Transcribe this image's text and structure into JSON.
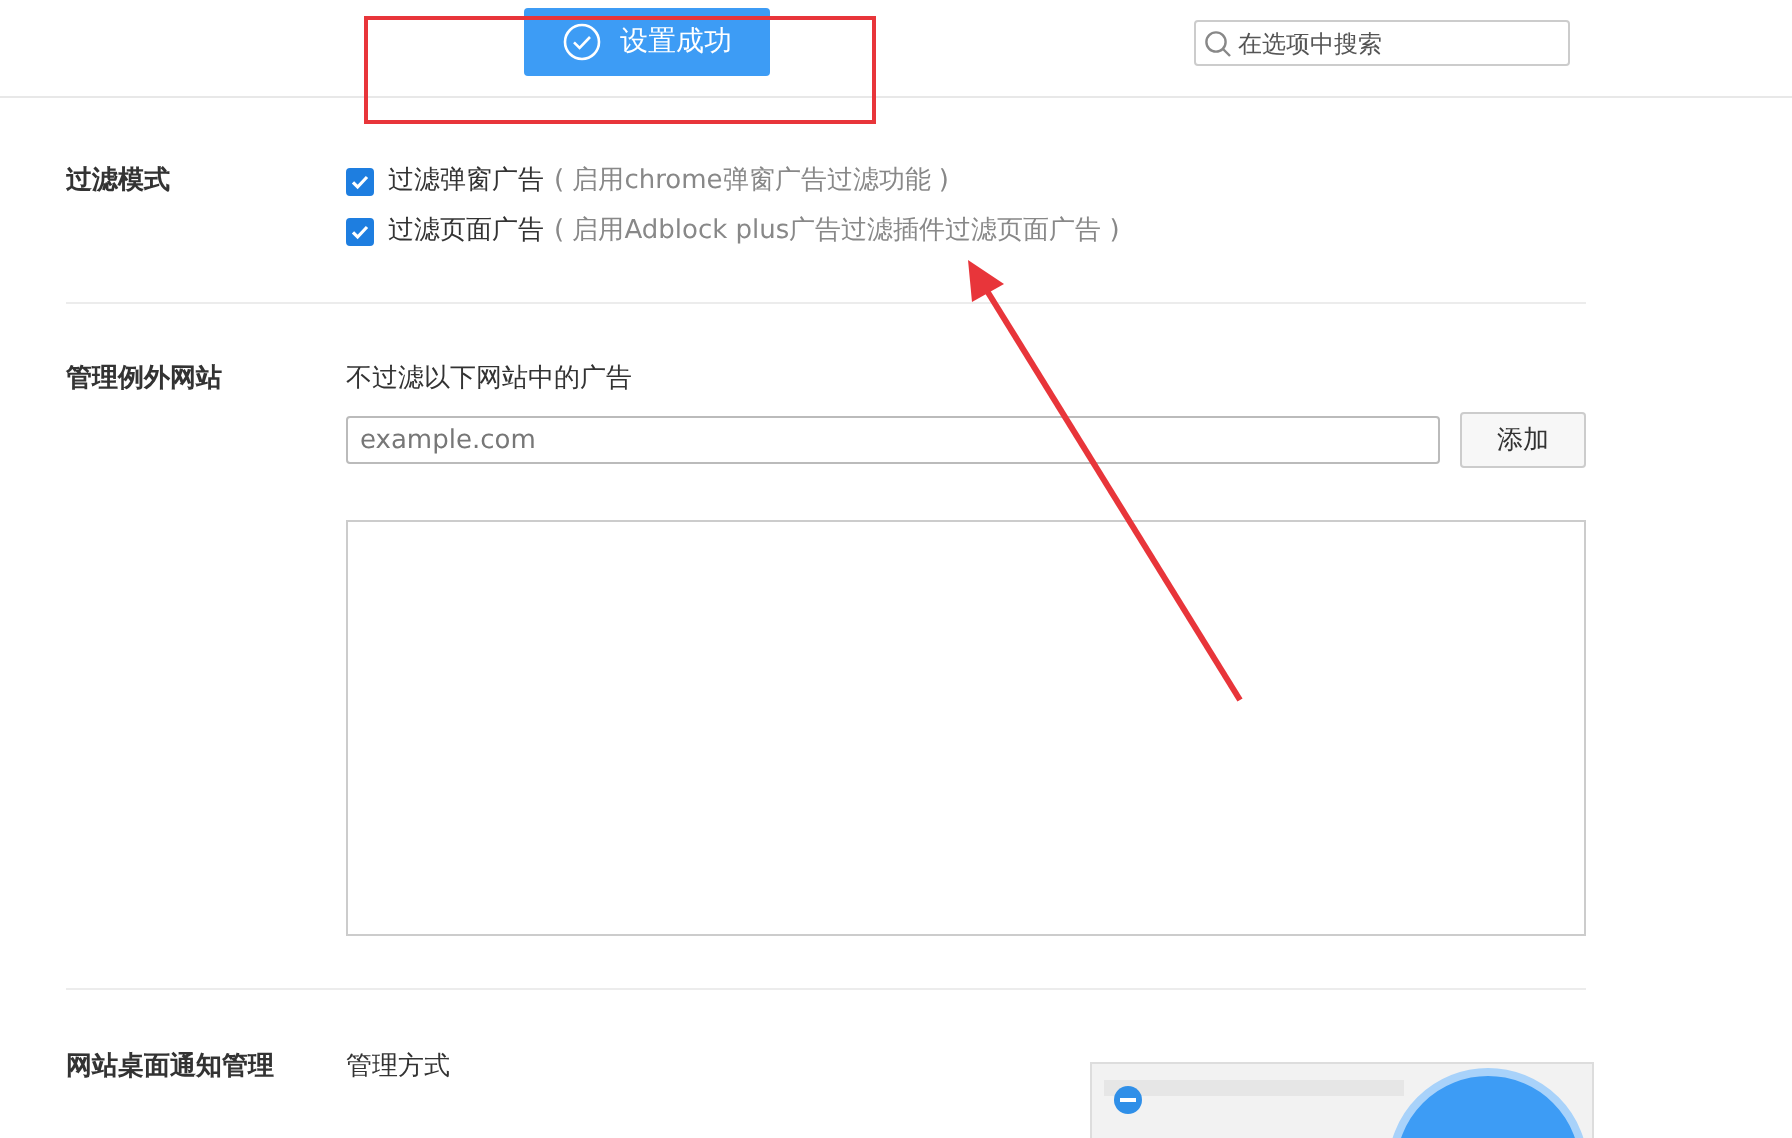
{
  "toast": {
    "text": "设置成功"
  },
  "search": {
    "placeholder": "在选项中搜索"
  },
  "filter_mode": {
    "label": "过滤模式",
    "options": [
      {
        "label": "过滤弹窗广告",
        "hint": "( 启用chrome弹窗广告过滤功能 )",
        "checked": true
      },
      {
        "label": "过滤页面广告",
        "hint": "( 启用Adblock plus广告过滤插件过滤页面广告 )",
        "checked": true
      }
    ]
  },
  "exceptions": {
    "label": "管理例外网站",
    "description": "不过滤以下网站中的广告",
    "input": {
      "placeholder": "example.com"
    },
    "add_button": "添加"
  },
  "notifications": {
    "label": "网站桌面通知管理",
    "subtitle": "管理方式"
  }
}
